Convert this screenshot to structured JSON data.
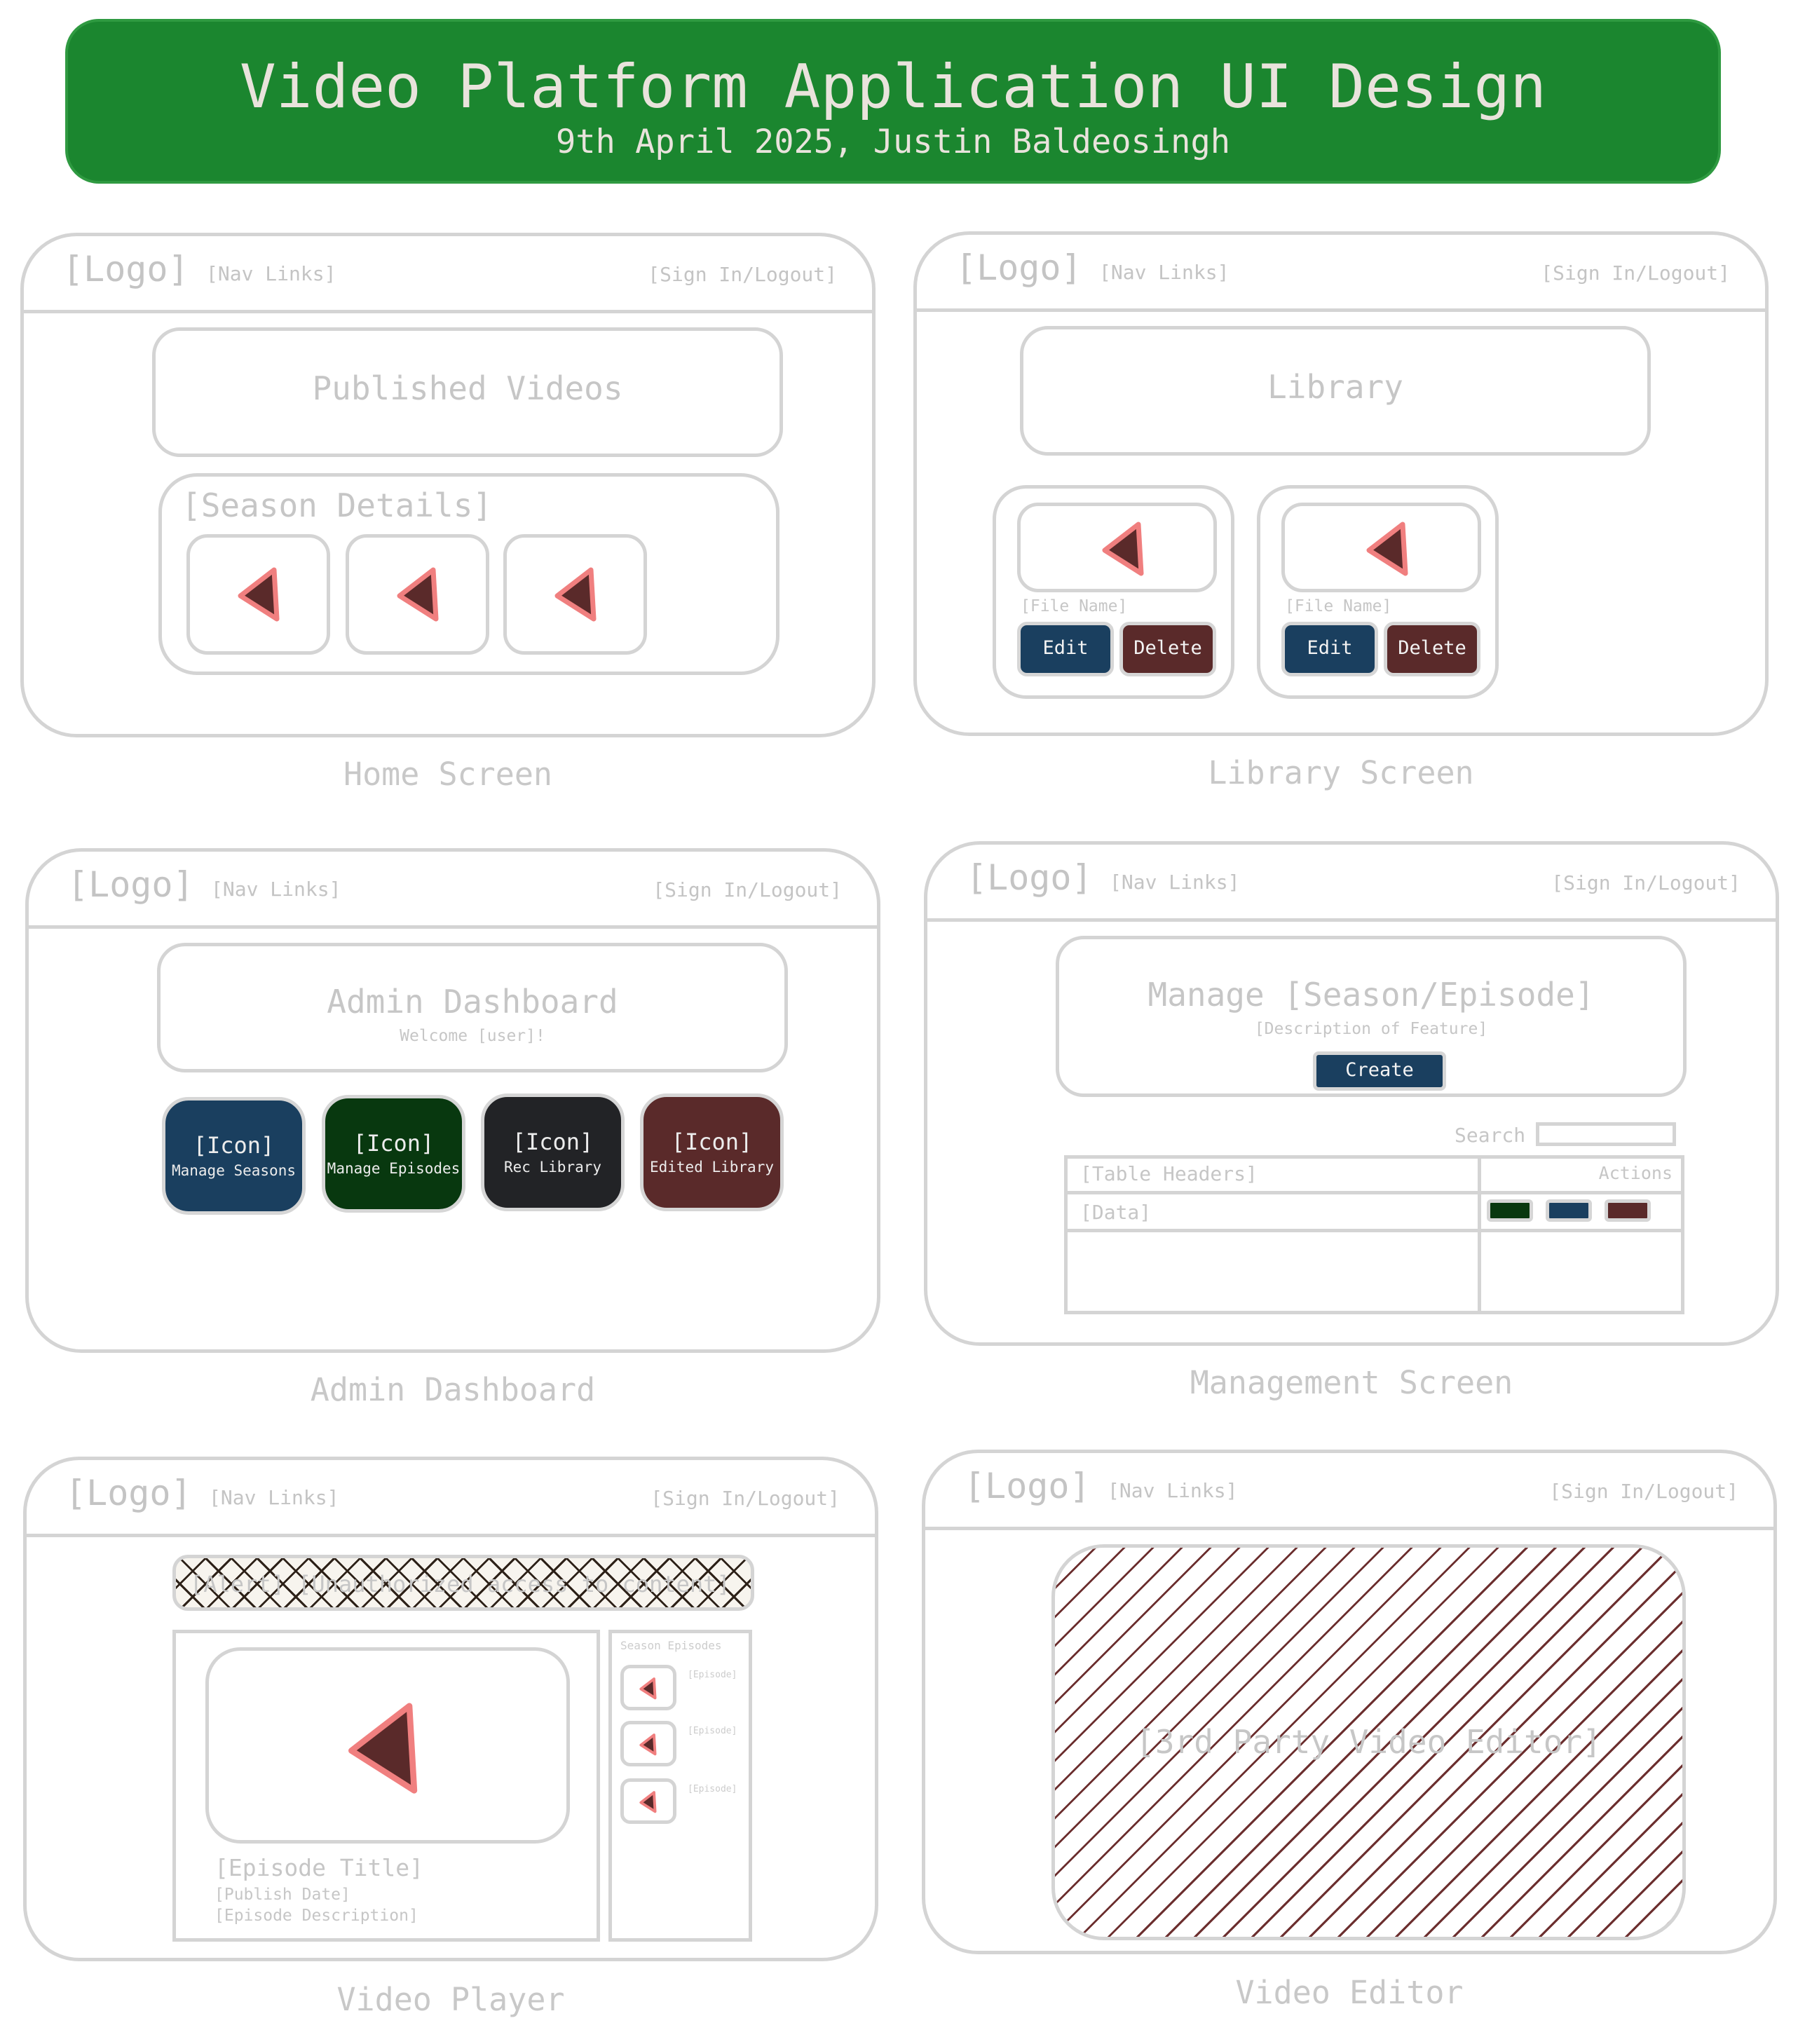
{
  "header": {
    "title": "Video Platform Application UI Design",
    "subtitle": "9th April 2025, Justin Baldeosingh"
  },
  "nav": {
    "logo": "[Logo]",
    "links": "[Nav Links]",
    "sign": "[Sign In/Logout]"
  },
  "home": {
    "caption": "Home Screen",
    "hero": "Published Videos",
    "season": "[Season Details]"
  },
  "library": {
    "caption": "Library Screen",
    "hero": "Library",
    "cards": [
      {
        "file": "[File Name]",
        "edit": "Edit",
        "delete": "Delete"
      },
      {
        "file": "[File Name]",
        "edit": "Edit",
        "delete": "Delete"
      }
    ]
  },
  "admin": {
    "caption": "Admin Dashboard",
    "title": "Admin Dashboard",
    "welcome": "Welcome [user]!",
    "tiles": [
      {
        "icon": "[Icon]",
        "label": "Manage Seasons",
        "color": "#1a3f5f"
      },
      {
        "icon": "[Icon]",
        "label": "Manage Episodes",
        "color": "#08380f"
      },
      {
        "icon": "[Icon]",
        "label": "Rec Library",
        "color": "#222326"
      },
      {
        "icon": "[Icon]",
        "label": "Edited Library",
        "color": "#5a2a2a"
      }
    ]
  },
  "manage": {
    "caption": "Management Screen",
    "title": "Manage [Season/Episode]",
    "desc": "[Description of Feature]",
    "create": "Create",
    "search": "Search",
    "table_headers": "[Table Headers]",
    "actions": "Actions",
    "data": "[Data]",
    "action_colors": [
      "#08380f",
      "#1a3f5f",
      "#5a2a2a"
    ]
  },
  "player": {
    "caption": "Video Player",
    "banner": "[Alert] [Unauthorized access to content]",
    "episode_title": "[Episode Title]",
    "publish_date": "[Publish Date]",
    "episode_desc": "[Episode Description]",
    "sidebar_title": "Season Episodes",
    "episodes": [
      "[Episode]",
      "[Episode]",
      "[Episode]"
    ]
  },
  "editor": {
    "caption": "Video Editor",
    "placeholder": "[3rd Party Video Editor]"
  },
  "colors": {
    "banner": "#1b862f",
    "play_fill": "#5a2a2a",
    "play_outline": "#f07f7f",
    "edit": "#1a3f5f",
    "delete": "#5a2a2a"
  }
}
